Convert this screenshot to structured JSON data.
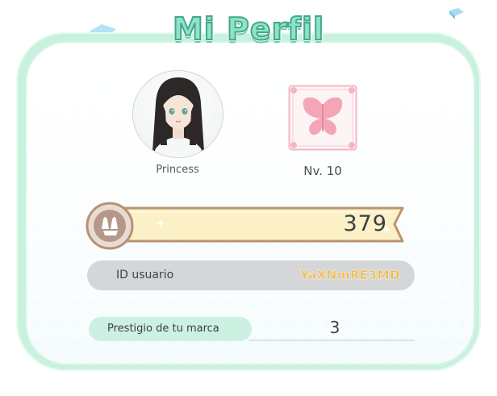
{
  "page": {
    "title": "Mi Perfil"
  },
  "profile": {
    "player_name": "Princess",
    "level_text": "Nv. 10",
    "emblem_icon": "butterfly-icon",
    "avatar_icon": "avatar-portrait"
  },
  "score": {
    "value": "379",
    "icon": "medal-icon"
  },
  "user_id": {
    "label": "ID usuario",
    "value": "YaXNmRE3MD"
  },
  "prestige": {
    "label": "Prestigio de tu marca",
    "value": "3"
  },
  "colors": {
    "panel_border": "#c8f1de",
    "title_fill": "#8fe3c9",
    "title_outline": "#43a88a",
    "score_bar": "#fbf0c6",
    "id_value": "#f0b84b",
    "id_pill": "#d4d6d7",
    "prestige_pill": "#ccf0e2",
    "emblem": "#f7b6c4"
  }
}
